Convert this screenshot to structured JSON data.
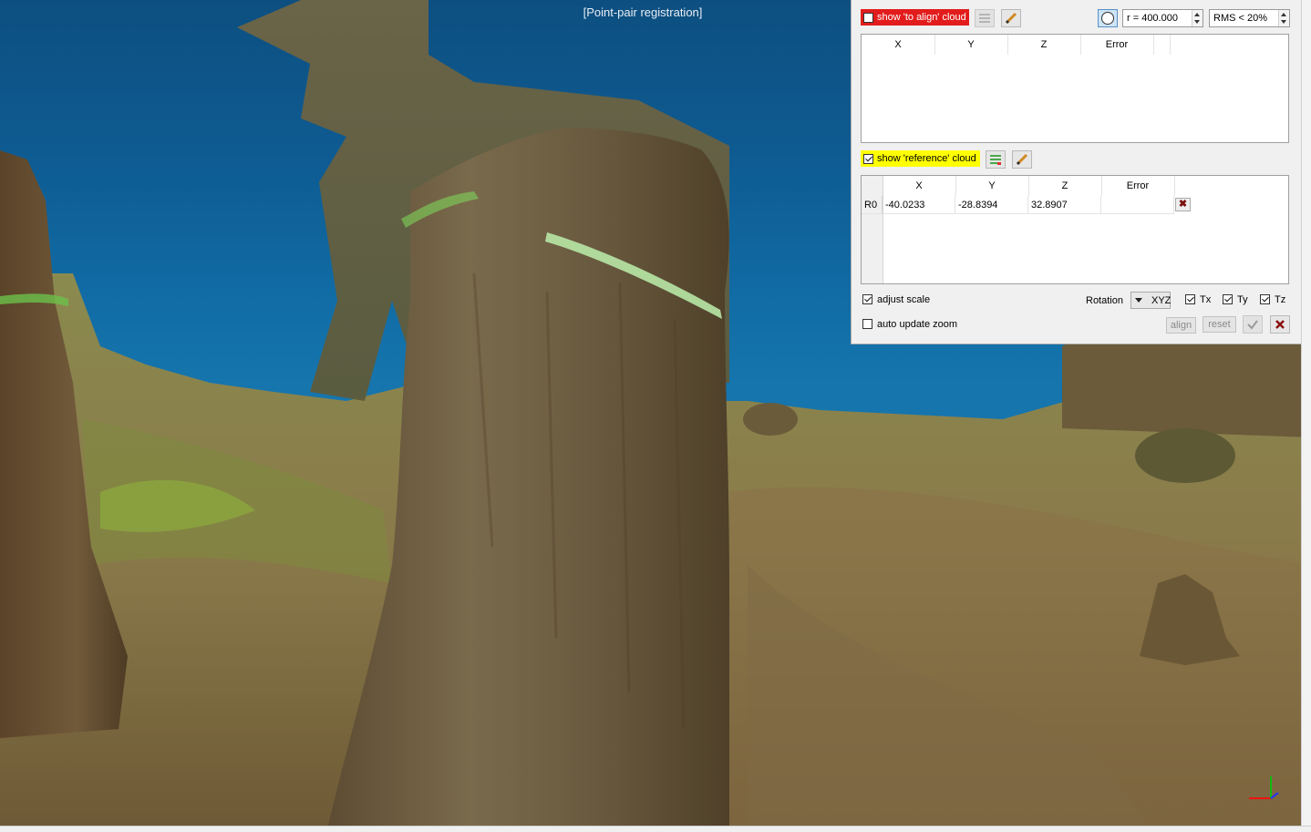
{
  "viewport": {
    "title": "[Point-pair registration]"
  },
  "to_align": {
    "checkbox_label": "show 'to align' cloud",
    "checked": false,
    "radius_value": "r = 400.000",
    "rms_value": "RMS < 20%",
    "columns": [
      "X",
      "Y",
      "Z",
      "Error"
    ],
    "rows": []
  },
  "reference": {
    "checkbox_label": "show 'reference' cloud",
    "checked": true,
    "columns": [
      "X",
      "Y",
      "Z",
      "Error"
    ],
    "rows": [
      {
        "id": "R0",
        "x": "-40.0233",
        "y": "-28.8394",
        "z": "32.8907",
        "error": ""
      }
    ]
  },
  "options": {
    "adjust_scale": "adjust scale",
    "auto_update_zoom": "auto update zoom",
    "rotation_label": "Rotation",
    "rotation_value": "XYZ",
    "tx": "Tx",
    "ty": "Ty",
    "tz": "Tz"
  },
  "buttons": {
    "align": "align",
    "reset": "reset"
  },
  "colors": {
    "to_align_highlight": "#e21c1c",
    "reference_highlight": "#ffff00",
    "sky": "#0e5c93"
  },
  "icons": [
    "pick-points-icon",
    "edit-pencil-icon",
    "sphere-icon",
    "validate-check-icon",
    "cancel-cross-icon",
    "axes-icon"
  ]
}
